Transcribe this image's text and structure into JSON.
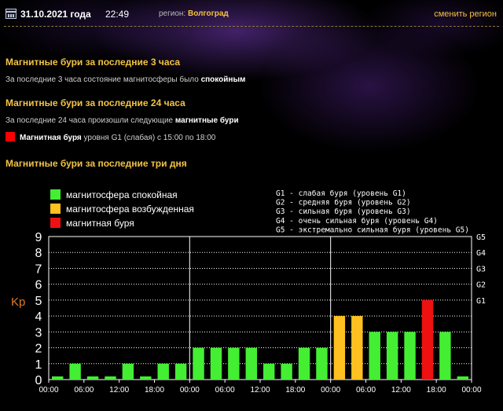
{
  "header": {
    "date": "31.10.2021 года",
    "time": "22:49",
    "region_label": "регион:",
    "region_name": "Волгоград",
    "change_region": "сменить регион"
  },
  "section3h": {
    "title": "Магнитные бури за последние 3 часа",
    "text_prefix": "За последние 3 часа состояние магнитосферы было ",
    "text_bold": "спокойным"
  },
  "section24h": {
    "title": "Магнитные бури за последние 24 часа",
    "text_prefix": "За последние 24 часа произошли следующие ",
    "text_bold": "магнитные бури",
    "storm_bold": "Магнитная буря",
    "storm_rest": " уровня G1 (слабая) с 15:00 по 18:00"
  },
  "section3d": {
    "title": "Магнитные бури за последние три дня"
  },
  "colors": {
    "calm": "#44ee33",
    "excited": "#ffc020",
    "storm": "#ee1111",
    "accent": "#f3c343"
  },
  "chart_data": {
    "type": "bar",
    "ylabel": "Kp",
    "ylim": [
      0,
      9
    ],
    "yticks": [
      "0",
      "1",
      "2",
      "3",
      "4",
      "5",
      "6",
      "7",
      "8",
      "9"
    ],
    "g_levels": [
      {
        "label": "G1",
        "kp": 5
      },
      {
        "label": "G2",
        "kp": 6
      },
      {
        "label": "G3",
        "kp": 7
      },
      {
        "label": "G4",
        "kp": 8
      },
      {
        "label": "G5",
        "kp": 9
      }
    ],
    "legend": [
      {
        "label": "магнитосфера спокойная",
        "status": "calm"
      },
      {
        "label": "магнитосфера возбужденная",
        "status": "excited"
      },
      {
        "label": "магнитная буря",
        "status": "storm"
      }
    ],
    "g_legend": [
      "G1 - слабая буря (уровень G1)",
      "G2 - средняя буря (уровень G2)",
      "G3 - сильная буря (уровень G3)",
      "G4 - очень сильная буря (уровень G4)",
      "G5 - экстремально сильная буря (уровень G5)"
    ],
    "xtick_labels": [
      "00:00",
      "06:00",
      "12:00",
      "18:00",
      "00:00",
      "06:00",
      "12:00",
      "18:00",
      "00:00",
      "06:00",
      "12:00",
      "18:00",
      "00:00"
    ],
    "values": [
      0,
      1,
      0,
      0,
      1,
      0,
      1,
      1,
      2,
      2,
      2,
      2,
      1,
      1,
      2,
      2,
      4,
      4,
      3,
      3,
      3,
      5,
      3,
      0
    ],
    "status": [
      "calm",
      "calm",
      "calm",
      "calm",
      "calm",
      "calm",
      "calm",
      "calm",
      "calm",
      "calm",
      "calm",
      "calm",
      "calm",
      "calm",
      "calm",
      "calm",
      "excited",
      "excited",
      "calm",
      "calm",
      "calm",
      "storm",
      "calm",
      "calm"
    ]
  }
}
